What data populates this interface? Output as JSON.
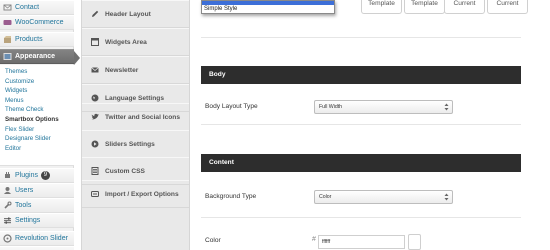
{
  "wp_menu": {
    "items_top": [
      {
        "label": "Contact"
      },
      {
        "label": "WooCommerce"
      },
      {
        "label": "Products"
      },
      {
        "label": "Appearance"
      }
    ],
    "submenu": [
      "Themes",
      "Customize",
      "Widgets",
      "Menus",
      "Theme Check",
      "Smartbox Options",
      "Flex Slider",
      "Designare Slider",
      "Editor"
    ],
    "items_bottom": [
      {
        "label": "Plugins",
        "badge": "9"
      },
      {
        "label": "Users"
      },
      {
        "label": "Tools"
      },
      {
        "label": "Settings"
      },
      {
        "label": "Revolution Slider"
      }
    ]
  },
  "options_tabs": [
    "Header Layout",
    "Widgets Area",
    "Newsletter",
    "Language Settings",
    "Twitter and Social Icons",
    "Sliders Settings",
    "Custom CSS",
    "Import / Export Options"
  ],
  "dropdown_list": {
    "option": "Simple Style"
  },
  "template_buttons": [
    "Template",
    "Template",
    "Current",
    "Current"
  ],
  "sections": {
    "body": {
      "title": "Body",
      "field_label": "Body Layout Type",
      "value": "Full Width"
    },
    "content": {
      "title": "Content",
      "bg_label": "Background Type",
      "bg_value": "Color",
      "color_label": "Color",
      "color_hash": "#",
      "color_value": "ffffff"
    }
  },
  "colors": {
    "accent_link": "#21759b",
    "active_menu": "#777777",
    "section_bar": "#2d2d2d",
    "dropdown_highlight": "#3d6fd8"
  }
}
